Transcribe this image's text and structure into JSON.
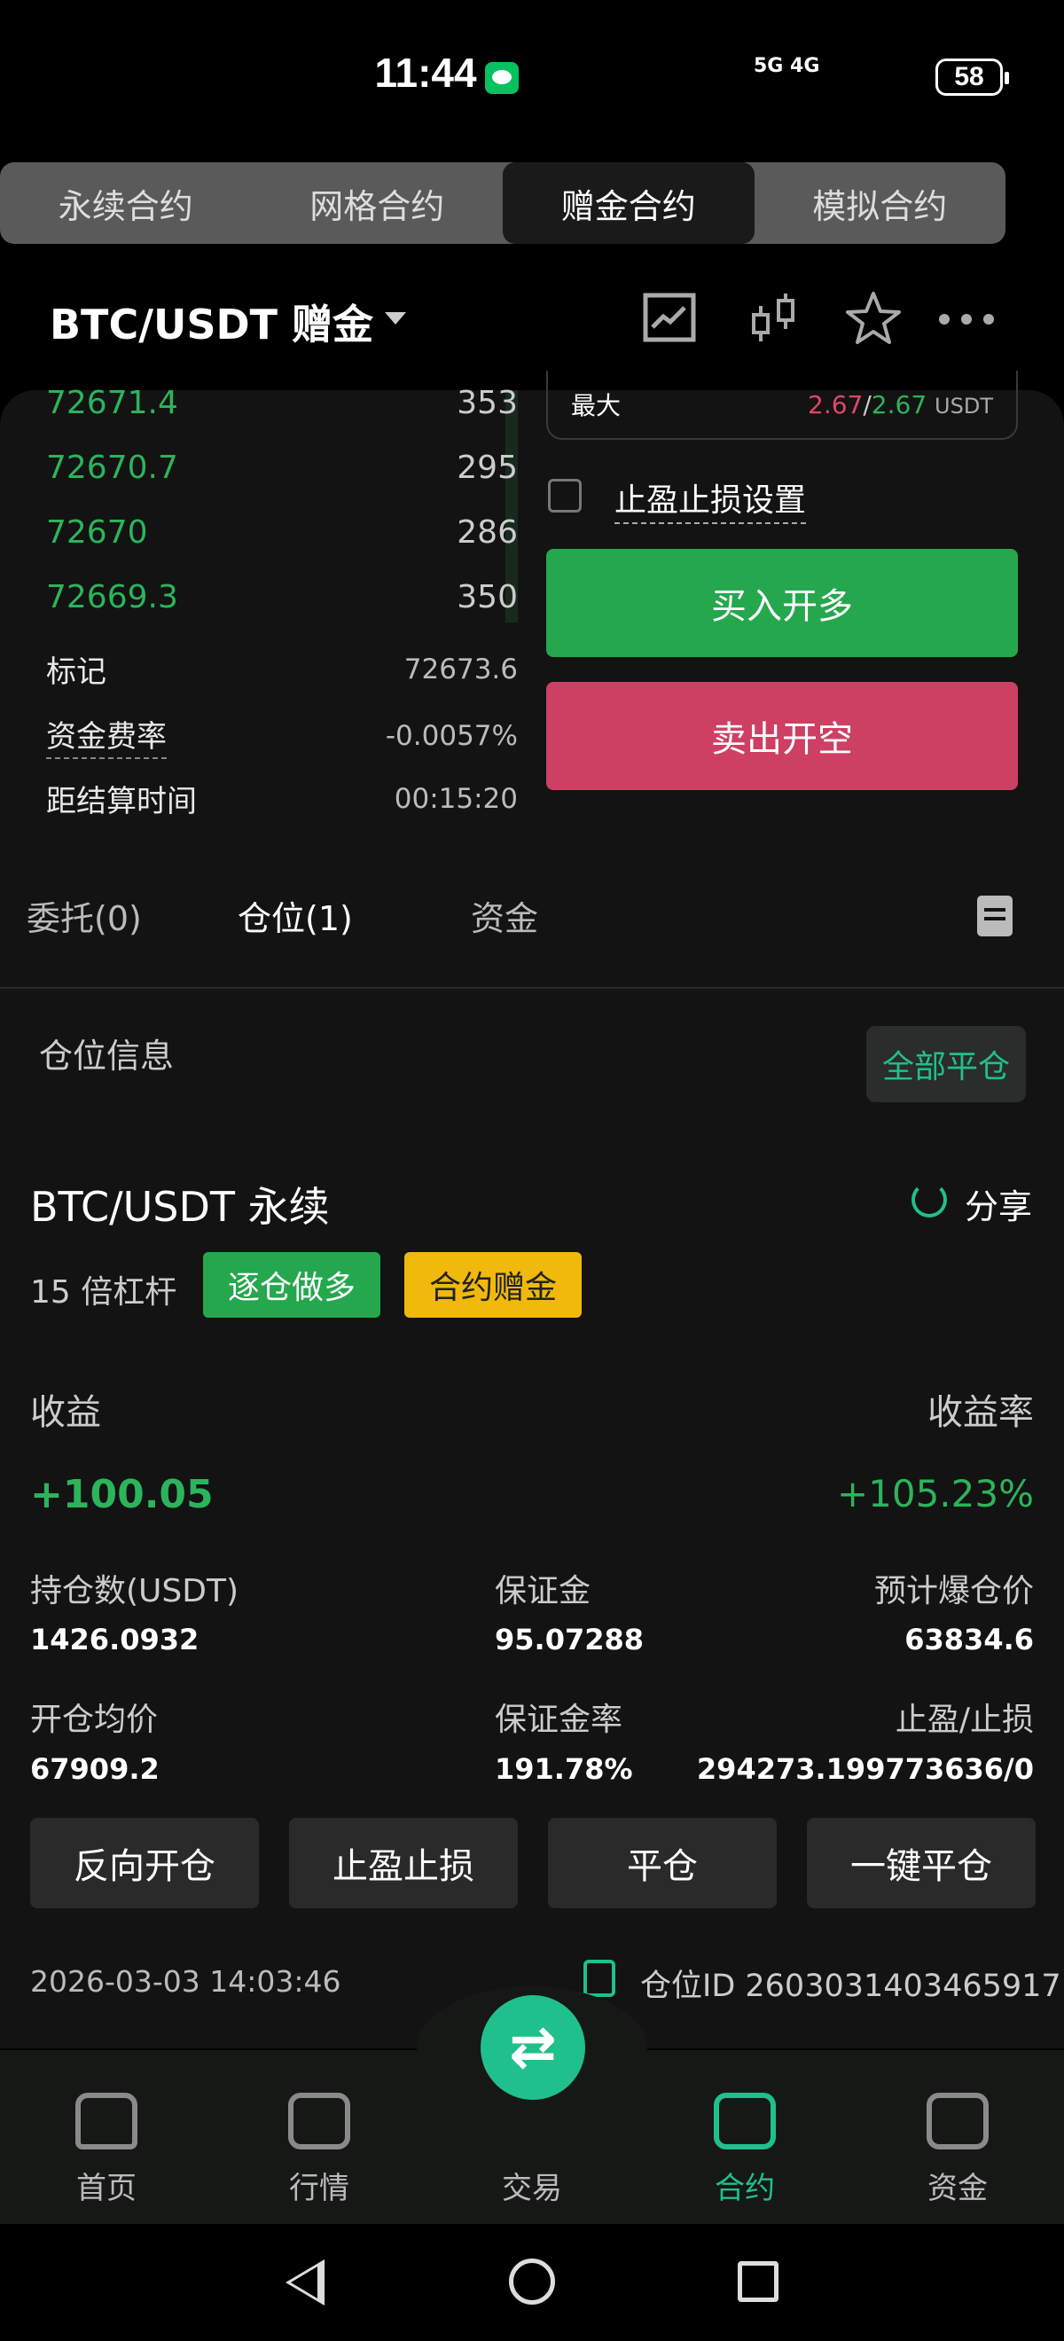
{
  "status_bar": {
    "time": "11:44",
    "signal": "5G 4G",
    "battery": "58"
  },
  "top_tabs": [
    {
      "label": "永续合约"
    },
    {
      "label": "网格合约"
    },
    {
      "label": "赠金合约"
    },
    {
      "label": "模拟合约"
    }
  ],
  "header": {
    "pair": "BTC/USDT  赠金"
  },
  "order_book": [
    {
      "price": "72671.4",
      "qty": "353"
    },
    {
      "price": "72670.7",
      "qty": "295"
    },
    {
      "price": "72670",
      "qty": "286"
    },
    {
      "price": "72669.3",
      "qty": "350"
    }
  ],
  "market_info": {
    "mark_label": "标记",
    "mark_value": "72673.6",
    "funding_label": "资金费率",
    "funding_value": "-0.0057%",
    "settle_label": "距结算时间",
    "settle_value": "00:15:20"
  },
  "trade_panel": {
    "max_label": "最大",
    "max_buy": "2.67",
    "max_sep": "/",
    "max_sell": "2.67",
    "max_unit": "USDT",
    "tpsl_label": "止盈止损设置",
    "buy_label": "买入开多",
    "sell_label": "卖出开空"
  },
  "order_tabs": [
    {
      "label": "委托(0)"
    },
    {
      "label": "仓位(1)"
    },
    {
      "label": "资金"
    }
  ],
  "position": {
    "section_label": "仓位信息",
    "close_all_label": "全部平仓",
    "pair": "BTC/USDT 永续",
    "share_label": "分享",
    "leverage": "15 倍杠杆",
    "tag_long": "逐仓做多",
    "tag_bonus": "合约赠金",
    "pnl_label": "收益",
    "pnl_value": "+100.05",
    "roe_label": "收益率",
    "roe_value": "+105.23%",
    "size_label": "持仓数(USDT)",
    "size_value": "1426.0932",
    "margin_label": "保证金",
    "margin_value": "95.07288",
    "liq_label": "预计爆仓价",
    "liq_value": "63834.6",
    "entry_label": "开仓均价",
    "entry_value": "67909.2",
    "margin_ratio_label": "保证金率",
    "margin_ratio_value": "191.78%",
    "tpsl_label": "止盈/止损",
    "tpsl_value": "294273.199773636/0",
    "actions": {
      "reverse": "反向开仓",
      "tpsl": "止盈止损",
      "close": "平仓",
      "quick_close": "一键平仓"
    },
    "time": "2026-03-03 14:03:46",
    "id": "仓位ID 2603031403465917"
  },
  "bottom_nav": [
    {
      "label": "首页",
      "icon": "home-icon"
    },
    {
      "label": "行情",
      "icon": "market-icon"
    },
    {
      "label": "交易",
      "icon": "swap-icon"
    },
    {
      "label": "合约",
      "icon": "contract-icon"
    },
    {
      "label": "资金",
      "icon": "wallet-icon"
    }
  ],
  "colors": {
    "up": "#2cb45c",
    "down": "#e0466d",
    "accent": "#1fc08c",
    "bonus": "#f0b90b"
  },
  "icons": [
    "wechat-icon",
    "chart-icon",
    "candlestick-icon",
    "star-icon",
    "more-icon",
    "share-icon",
    "copy-id-icon",
    "list-icon"
  ]
}
